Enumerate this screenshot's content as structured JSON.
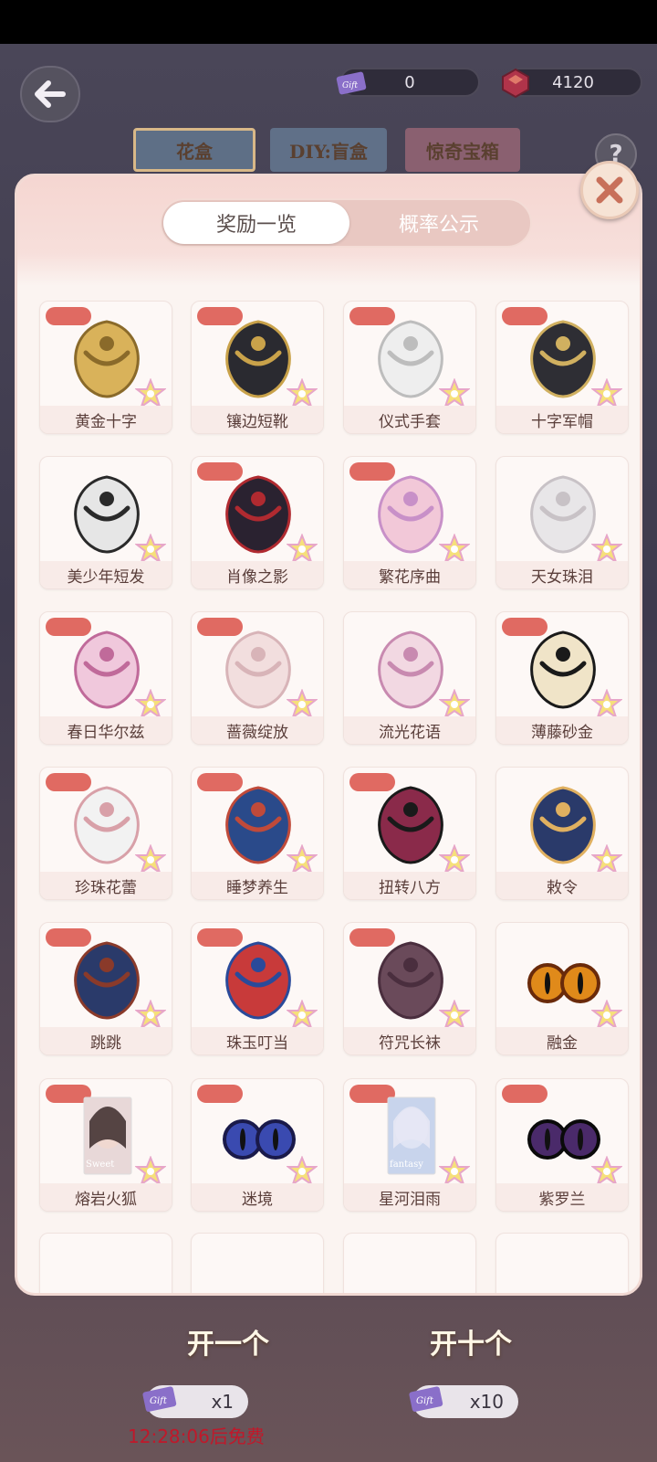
{
  "header": {
    "gift_value": "0",
    "gem_value": "4120",
    "tabs": [
      "花盒",
      "DIY:盲盒",
      "惊奇宝箱"
    ],
    "help_label": "?"
  },
  "modal": {
    "tabs": {
      "active": "奖励一览",
      "inactive": "概率公示"
    },
    "items": [
      "黄金十字",
      "镶边短靴",
      "仪式手套",
      "十字军帽",
      "美少年短发",
      "肖像之影",
      "繁花序曲",
      "天女珠泪",
      "春日华尔兹",
      "蔷薇绽放",
      "流光花语",
      "薄藤砂金",
      "珍珠花蕾",
      "睡梦养生",
      "扭转八方",
      "敕令",
      "跳跳",
      "珠玉叮当",
      "符咒长袜",
      "融金",
      "熔岩火狐",
      "迷境",
      "星河泪雨",
      "紫罗兰"
    ],
    "card_texts": {
      "sweet": "Sweet",
      "fantasy": "fantasy"
    },
    "gift_icon_text": "Gift"
  },
  "footer": {
    "open_one": "开一个",
    "open_ten": "开十个",
    "count_one": "x1",
    "count_ten": "x10",
    "timer": "12:28:06后免费"
  }
}
